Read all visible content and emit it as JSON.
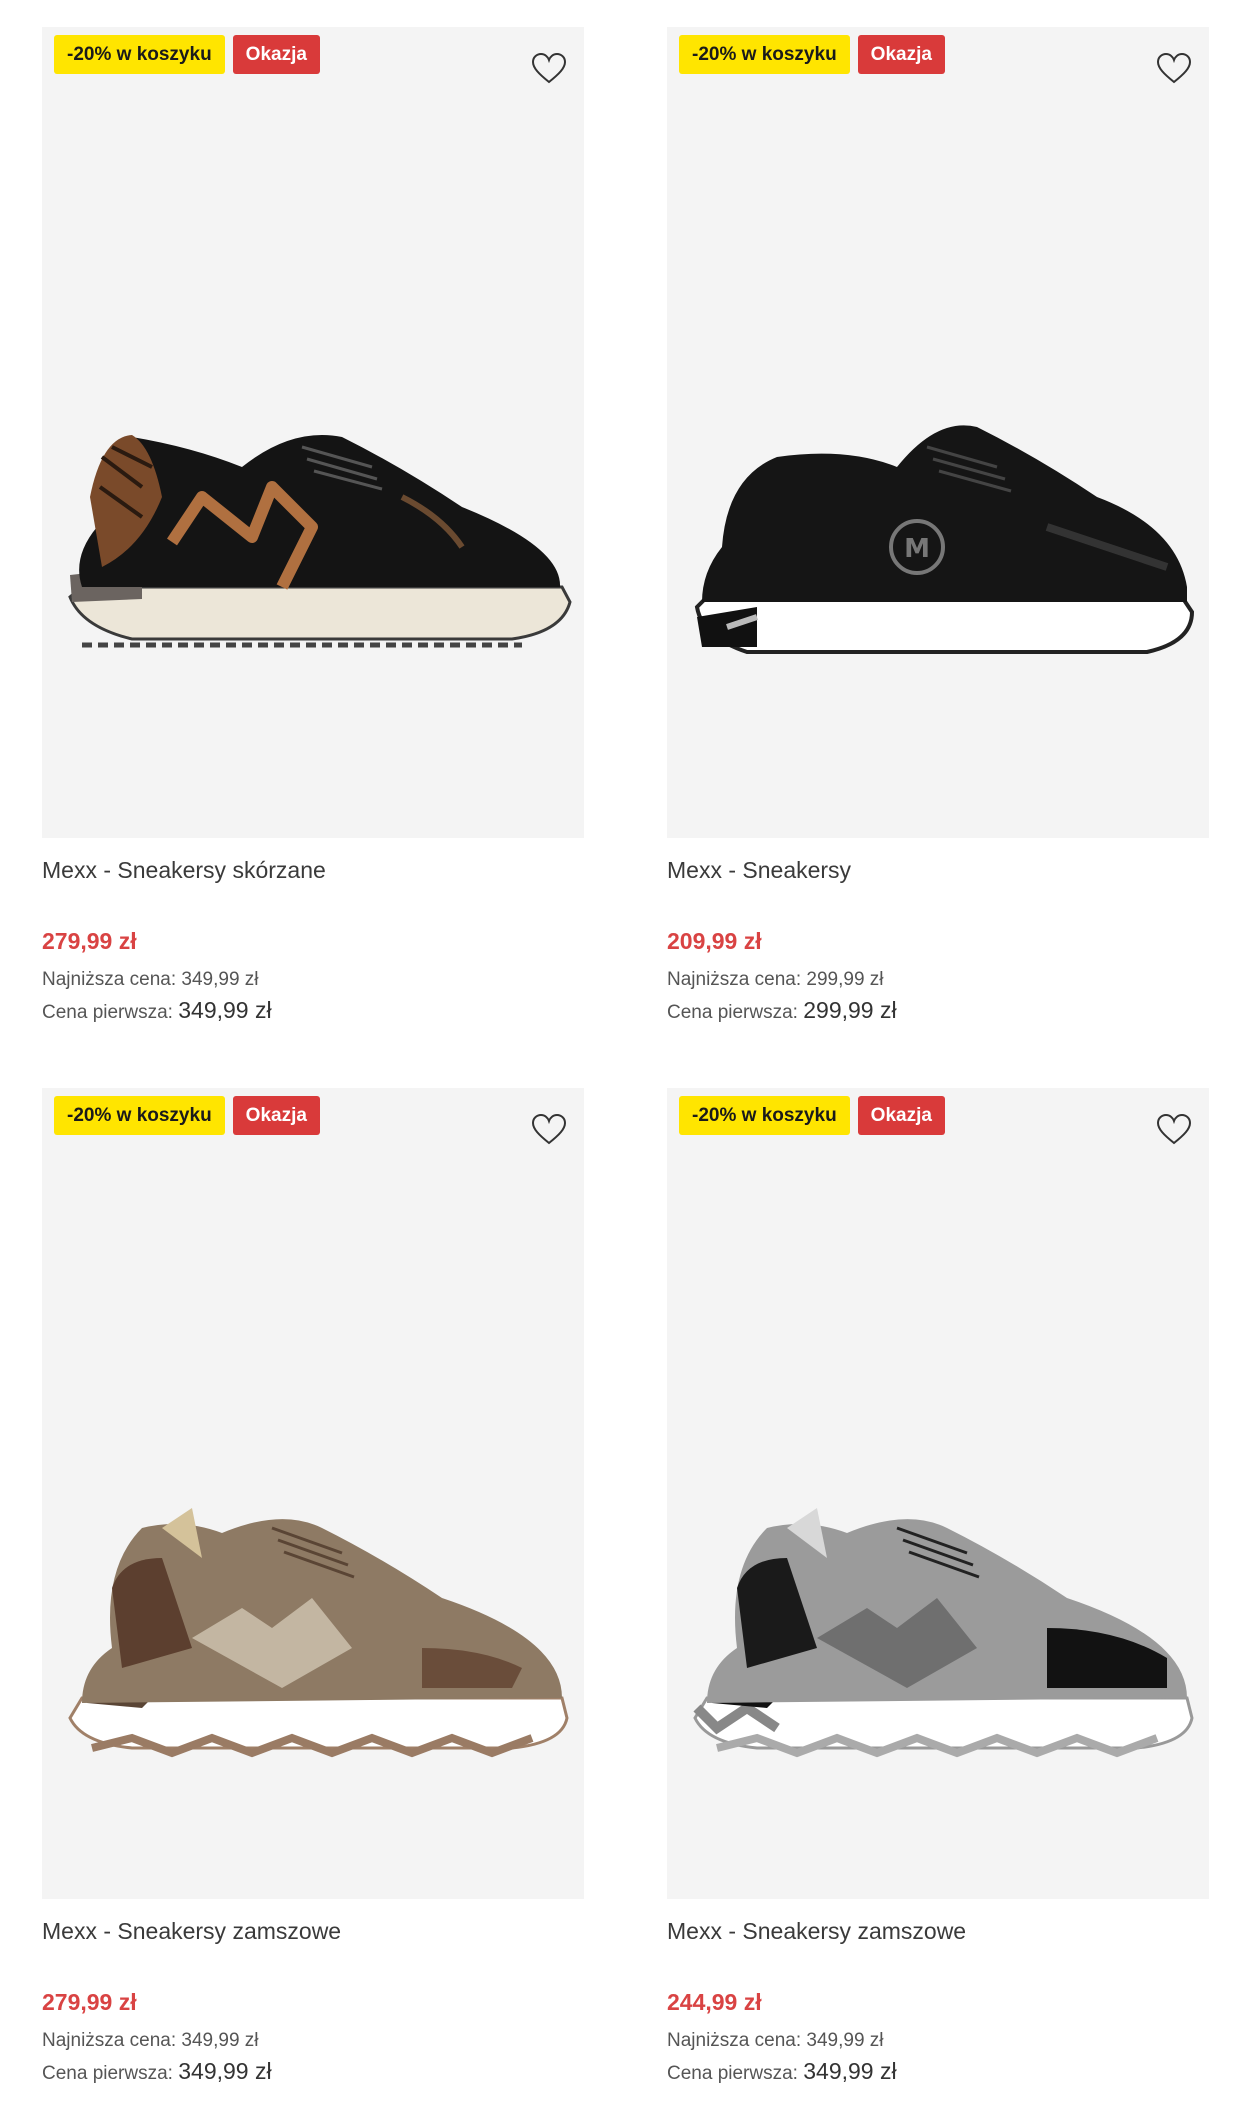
{
  "products": [
    {
      "badge_promo": "-20% w koszyku",
      "badge_deal": "Okazja",
      "title": "Mexx - Sneakersy skórzane",
      "price": "279,99 zł",
      "lowest_label": "Najniższa cena:",
      "lowest_value": "349,99 zł",
      "first_label": "Cena pierwsza:",
      "first_value": "349,99 zł",
      "icon": "heart-outline-icon"
    },
    {
      "badge_promo": "-20% w koszyku",
      "badge_deal": "Okazja",
      "title": "Mexx - Sneakersy",
      "price": "209,99 zł",
      "lowest_label": "Najniższa cena:",
      "lowest_value": "299,99 zł",
      "first_label": "Cena pierwsza:",
      "first_value": "299,99 zł",
      "icon": "heart-outline-icon"
    },
    {
      "badge_promo": "-20% w koszyku",
      "badge_deal": "Okazja",
      "title": "Mexx - Sneakersy zamszowe",
      "price": "279,99 zł",
      "lowest_label": "Najniższa cena:",
      "lowest_value": "349,99 zł",
      "first_label": "Cena pierwsza:",
      "first_value": "349,99 zł",
      "icon": "heart-outline-icon"
    },
    {
      "badge_promo": "-20% w koszyku",
      "badge_deal": "Okazja",
      "title": "Mexx - Sneakersy zamszowe",
      "price": "244,99 zł",
      "lowest_label": "Najniższa cena:",
      "lowest_value": "349,99 zł",
      "first_label": "Cena pierwsza:",
      "first_value": "349,99 zł",
      "icon": "heart-outline-icon"
    }
  ],
  "colors": {
    "promo_badge": "#ffe500",
    "deal_badge": "#d93a3a",
    "price": "#d94343",
    "image_bg": "#f4f4f4"
  }
}
